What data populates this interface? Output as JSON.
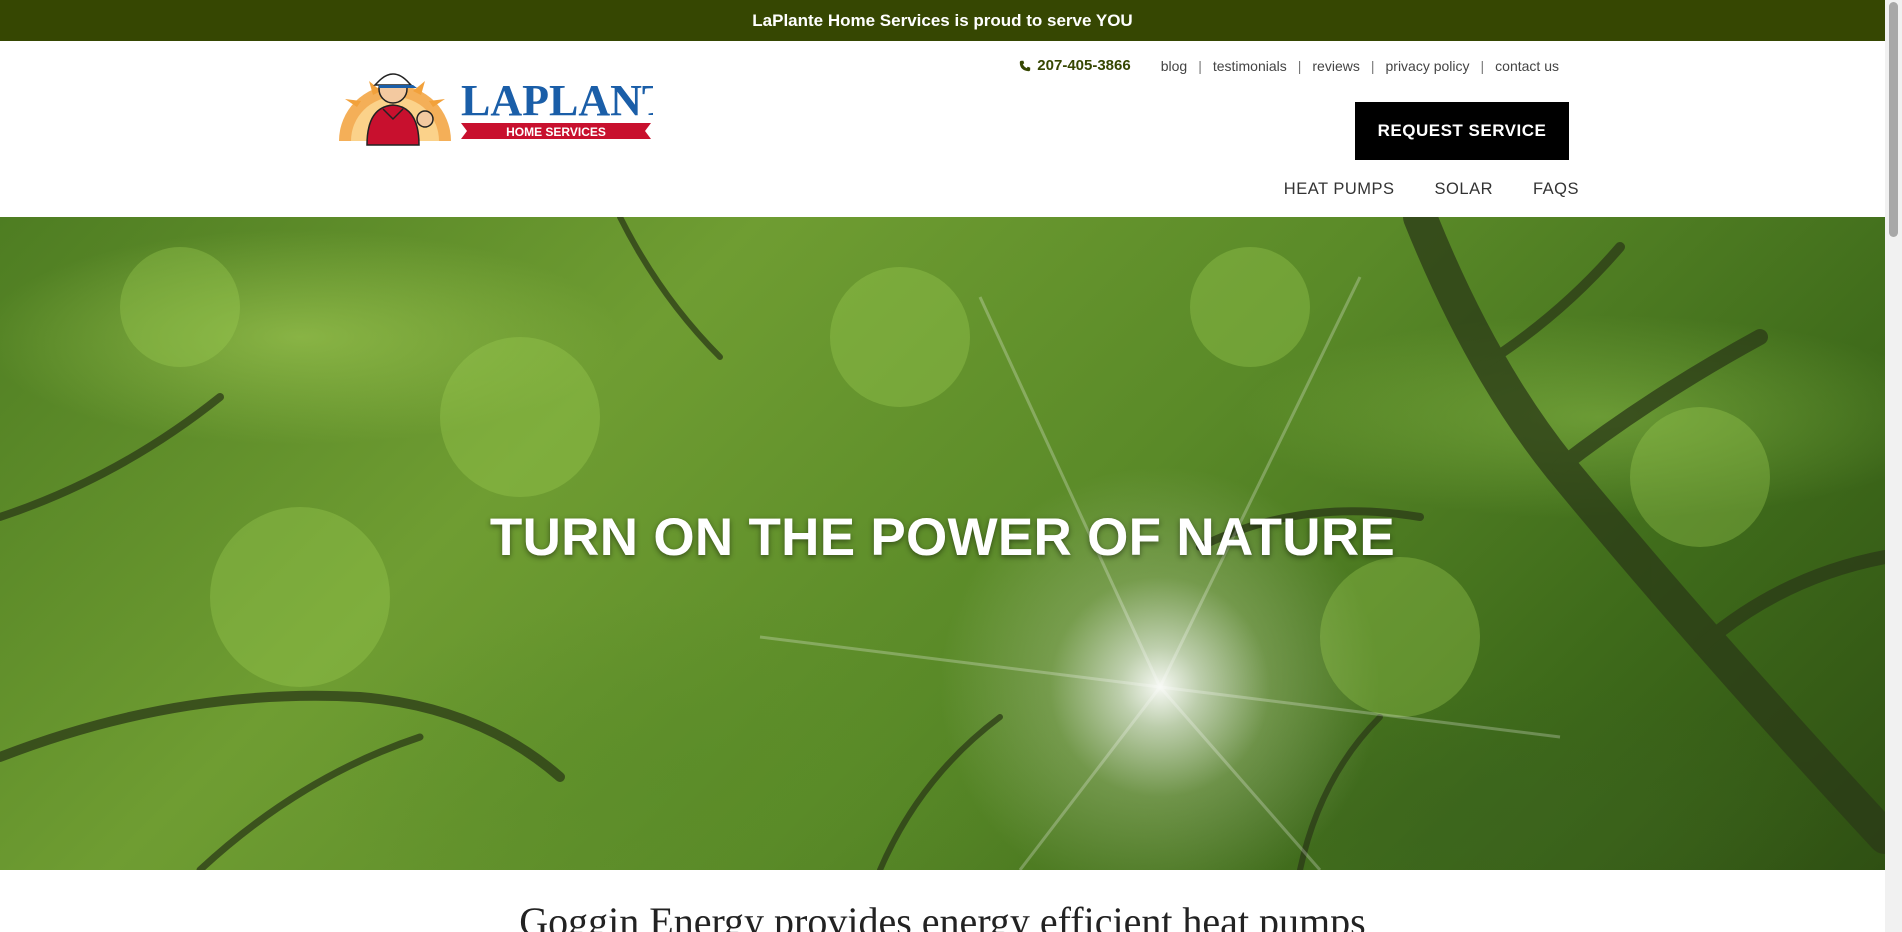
{
  "announcement": "LaPlante Home Services is proud to serve YOU",
  "logo": {
    "brand": "LAPLANTE",
    "tagline": "HOME SERVICES"
  },
  "utility": {
    "phone": "207-405-3866",
    "links": [
      "blog",
      "testimonials",
      "reviews",
      "privacy policy",
      "contact us"
    ]
  },
  "cta": "REQUEST SERVICE",
  "nav": [
    "HEAT PUMPS",
    "SOLAR",
    "FAQS"
  ],
  "hero": {
    "title": "TURN ON THE POWER OF NATURE"
  },
  "intro": "Goggin Energy provides energy efficient heat pumps",
  "colors": {
    "topbar": "#364702",
    "cta_bg": "#000000",
    "logo_blue": "#1a5ea8",
    "logo_red": "#c8102e",
    "logo_sun": "#f2a13b"
  }
}
